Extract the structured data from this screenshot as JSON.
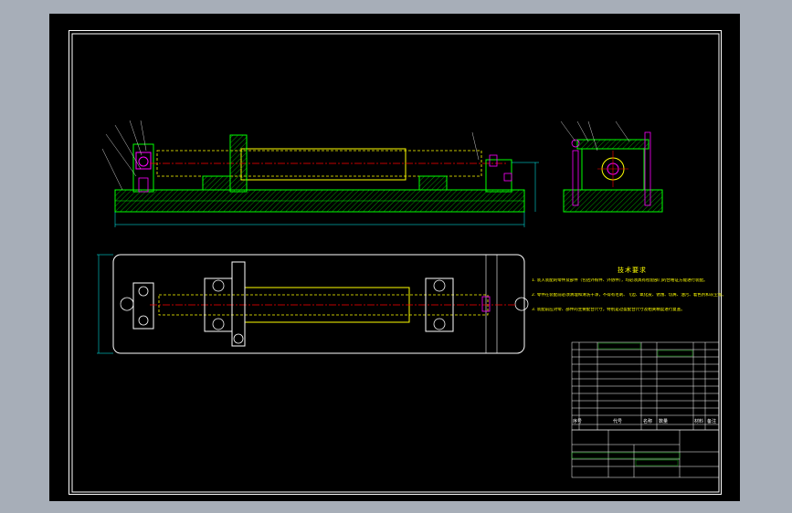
{
  "technical_requirements": {
    "title": "技术要求",
    "items": [
      "1. 装入装配的零件及部件（包括外购件、外协件），均必须具有检验部门的合格证方能进行装配。",
      "2. 零件在装配前必须清理和清洗干净，不得有毛刺、飞边、氧化皮、锈蚀、切屑、油污、着色剂和灰尘等。",
      "3. 装配前应对零、部件的主要配合尺寸，特别是过盈配合尺寸及相关精度进行复查。"
    ]
  },
  "title_block": {
    "header_labels": [
      "序号",
      "代号",
      "名称",
      "数量",
      "材料",
      "备注"
    ]
  },
  "colors": {
    "background": "#000000",
    "frame": "#ffffff",
    "part_outline": "#00ff00",
    "dimension": "#00ffff",
    "centerline": "#ff0000",
    "hidden_line": "#ffff00",
    "hatch": "#00ff00",
    "fastener": "#ff00ff"
  }
}
